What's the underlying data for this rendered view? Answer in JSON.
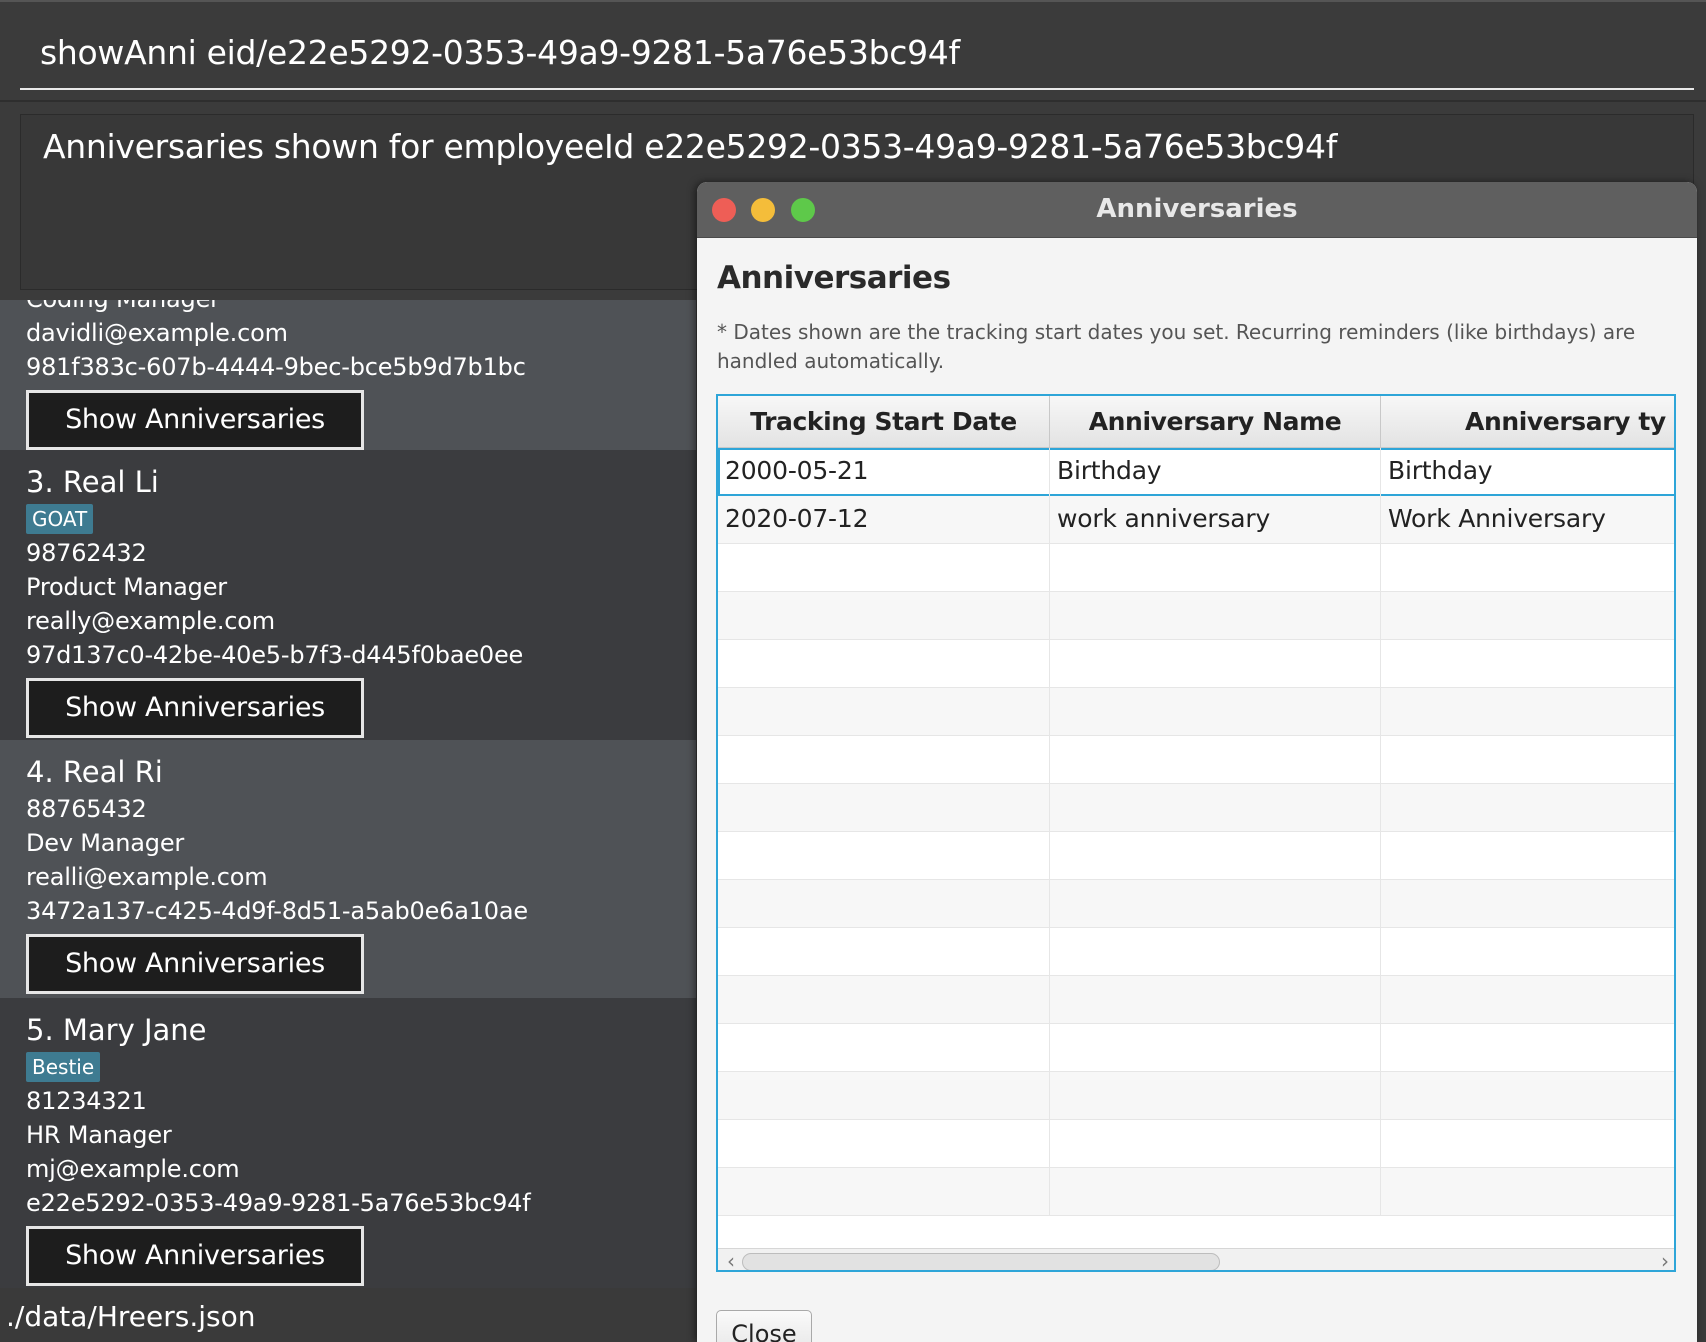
{
  "command": {
    "value": "showAnni eid/e22e5292-0353-49a9-9281-5a76e53bc94f"
  },
  "result": {
    "message": "Anniversaries shown for employeeId e22e5292-0353-49a9-9281-5a76e53bc94f"
  },
  "cards": [
    {
      "partial_title": "Coding Manager",
      "email": "davidli@example.com",
      "id": "981f383c-607b-4444-9bec-bce5b9d7b1bc",
      "button": "Show Anniversaries"
    },
    {
      "title": "3. Real Li",
      "tag": "GOAT",
      "phone": "98762432",
      "role": "Product Manager",
      "email": "really@example.com",
      "id": "97d137c0-42be-40e5-b7f3-d445f0bae0ee",
      "button": "Show Anniversaries"
    },
    {
      "title": "4. Real Ri",
      "phone": "88765432",
      "role": "Dev Manager",
      "email": "realli@example.com",
      "id": "3472a137-c425-4d9f-8d51-a5ab0e6a10ae",
      "button": "Show Anniversaries"
    },
    {
      "title": "5. Mary Jane",
      "tag": "Bestie",
      "phone": "81234321",
      "role": "HR Manager",
      "email": "mj@example.com",
      "id": "e22e5292-0353-49a9-9281-5a76e53bc94f",
      "button": "Show Anniversaries"
    }
  ],
  "status": {
    "path": "./data/Hreers.json"
  },
  "dialog": {
    "window_title": "Anniversaries",
    "heading": "Anniversaries",
    "note": "* Dates shown are the tracking start dates you set. Recurring reminders (like birthdays) are handled automatically.",
    "columns": [
      "Tracking Start Date",
      "Anniversary Name",
      "Anniversary ty"
    ],
    "rows": [
      [
        "2000-05-21",
        "Birthday",
        "Birthday"
      ],
      [
        "2020-07-12",
        "work anniversary",
        "Work Anniversary"
      ]
    ],
    "close_label": "Close"
  },
  "colors": {
    "accent": "#2ea5d8",
    "tag": "#3e7b91",
    "close_light": "#ee5e56",
    "minimize_light": "#f4bd3a",
    "maximize_light": "#5ec94a"
  }
}
